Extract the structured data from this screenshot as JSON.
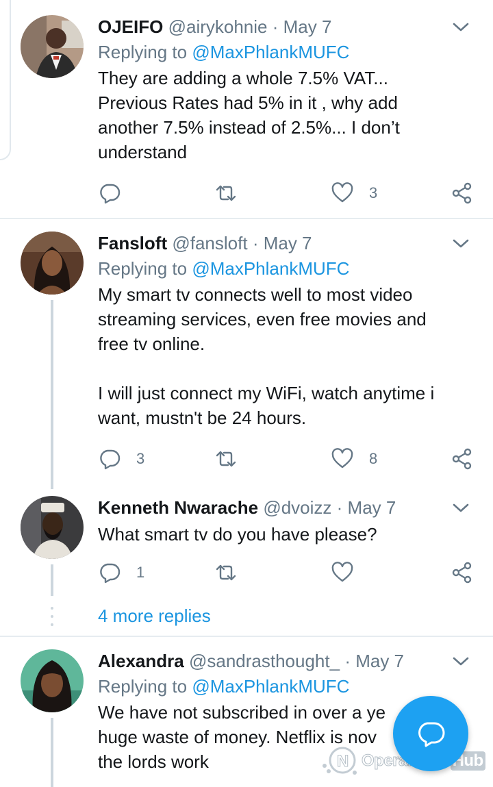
{
  "tweets": [
    {
      "name": "OJEIFO",
      "handle": "@airykohnie",
      "date": "May 7",
      "replying_prefix": "Replying to ",
      "replying_to": "@MaxPhlankMUFC",
      "text": "They are adding a whole 7.5% VAT...\nPrevious Rates had 5% in it , why add\nanother 7.5% instead of 2.5%... I don’t\nunderstand",
      "replies": "",
      "likes": "3"
    },
    {
      "name": "Fansloft",
      "handle": "@fansloft",
      "date": "May 7",
      "replying_prefix": "Replying to ",
      "replying_to": "@MaxPhlankMUFC",
      "text": "My smart tv connects well to most video\nstreaming services, even free movies and\nfree tv online.\n\nI will just connect my WiFi, watch anytime i\nwant, mustn't be 24 hours.",
      "replies": "3",
      "likes": "8"
    },
    {
      "name": "Kenneth Nwarache",
      "handle": "@dvoizz",
      "date": "May 7",
      "text": "What smart tv do you have please?",
      "replies": "1",
      "likes": ""
    },
    {
      "name": "Alexandra",
      "handle": "@sandrasthought_",
      "date": "May 7",
      "replying_prefix": "Replying to ",
      "replying_to": "@MaxPhlankMUFC",
      "text": "We have not subscribed in over a ye      a\nhuge waste of money. Netflix is nov\nthe lords work"
    }
  ],
  "separator": "·",
  "more_replies": "4 more replies",
  "watermark": {
    "opera": "OperaNews",
    "hub": "Hub"
  },
  "colors": {
    "accent": "#1da1f2",
    "link": "#1b95e0",
    "muted": "#657786"
  },
  "icons": [
    "reply-icon",
    "retweet-icon",
    "like-icon",
    "share-icon",
    "chevron-down-icon",
    "compose-icon"
  ]
}
